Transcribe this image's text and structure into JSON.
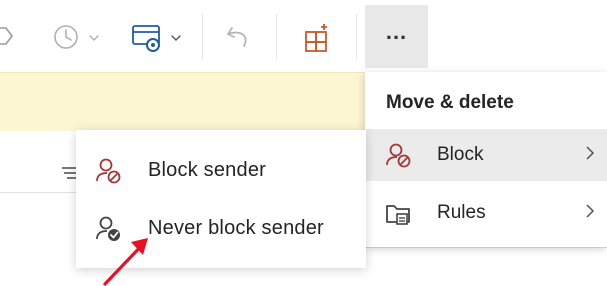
{
  "toolbar": {
    "icons": [
      "pin-icon",
      "snooze-icon",
      "rules-icon",
      "undo-icon",
      "apps-icon"
    ],
    "more_label": "..."
  },
  "move_delete_menu": {
    "header": "Move & delete",
    "items": [
      {
        "label": "Block",
        "icon": "block-person-icon",
        "has_submenu": true,
        "active": true
      },
      {
        "label": "Rules",
        "icon": "rules-folder-icon",
        "has_submenu": true,
        "active": false
      }
    ]
  },
  "block_submenu": {
    "items": [
      {
        "label": "Block sender",
        "icon": "block-sender-icon"
      },
      {
        "label": "Never block sender",
        "icon": "never-block-sender-icon"
      }
    ]
  },
  "colors": {
    "notice_background": "#fdf6d3",
    "block_icon": "#a4373a",
    "arrow": "#e81123",
    "apps_icon": "#c85a28",
    "rules_icon": "#1f5d9c"
  }
}
